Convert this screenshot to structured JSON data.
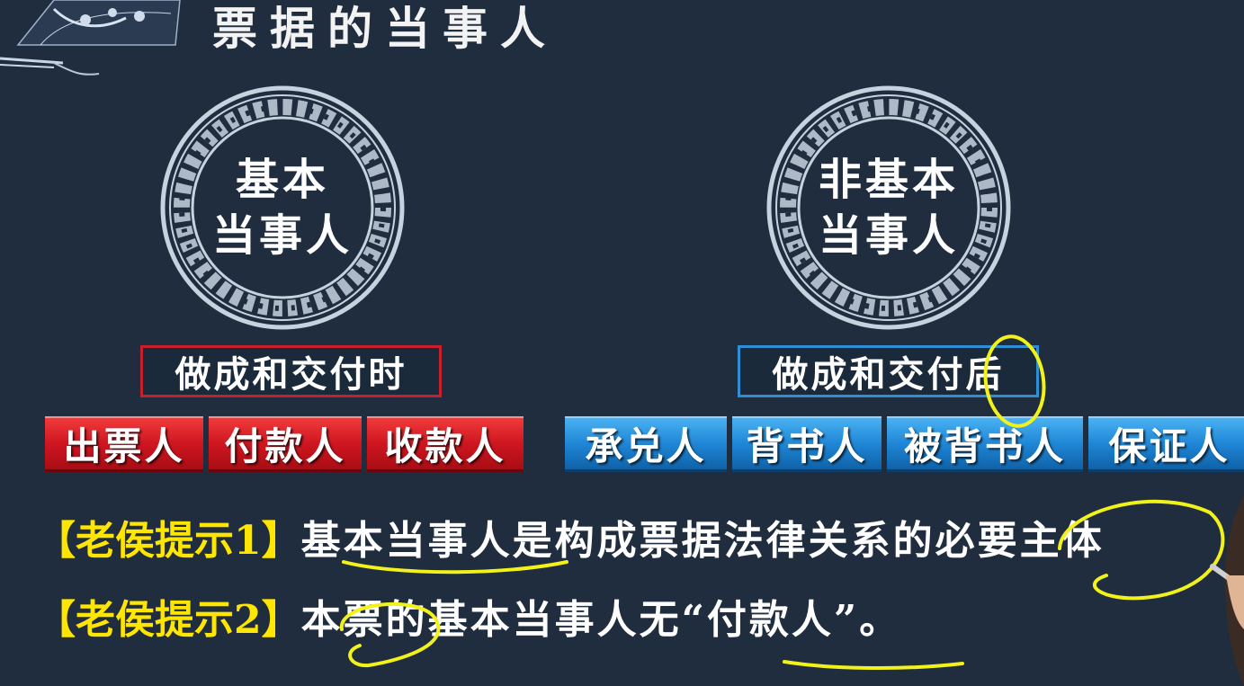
{
  "title": "票据的当事人",
  "basic": {
    "plate_line1": "基本",
    "plate_line2": "当事人",
    "timing": "做成和交付时",
    "parties": [
      "出票人",
      "付款人",
      "收款人"
    ]
  },
  "nonbasic": {
    "plate_line1": "非基本",
    "plate_line2": "当事人",
    "timing": "做成和交付后",
    "parties": [
      "承兑人",
      "背书人",
      "被背书人",
      "保证人"
    ]
  },
  "tips": [
    {
      "label": "【老侯提示1】",
      "text": "基本当事人是构成票据法律关系的必要主体"
    },
    {
      "label": "【老侯提示2】",
      "text": "本票的基本当事人无“付款人”。"
    }
  ],
  "colors": {
    "background": "#1f2d3f",
    "basic_accent": "#c8202a",
    "nonbasic_accent": "#2f8fd6",
    "tip_label": "#ffe600",
    "annotation": "#f2f21a"
  }
}
